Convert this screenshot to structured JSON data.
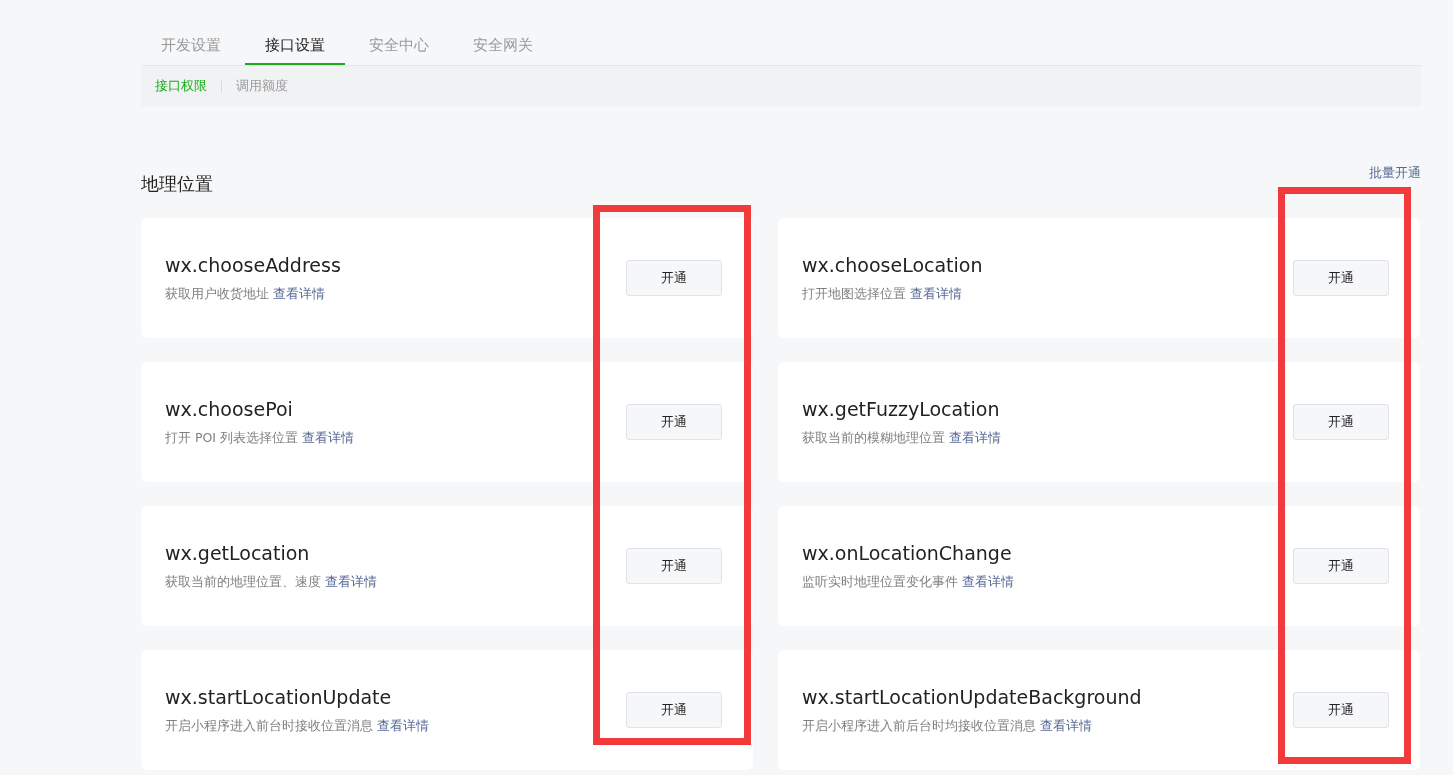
{
  "tabs": [
    {
      "label": "开发设置",
      "selected": false
    },
    {
      "label": "接口设置",
      "selected": true
    },
    {
      "label": "安全中心",
      "selected": false
    },
    {
      "label": "安全网关",
      "selected": false
    }
  ],
  "subtabs": [
    {
      "label": "接口权限",
      "selected": true
    },
    {
      "label": "调用额度",
      "selected": false
    }
  ],
  "section": {
    "title": "地理位置",
    "action": "批量开通"
  },
  "apis": [
    {
      "name": "wx.chooseAddress",
      "desc": "获取用户收货地址",
      "link": "查看详情",
      "button": "开通"
    },
    {
      "name": "wx.chooseLocation",
      "desc": "打开地图选择位置",
      "link": "查看详情",
      "button": "开通"
    },
    {
      "name": "wx.choosePoi",
      "desc": "打开 POI 列表选择位置",
      "link": "查看详情",
      "button": "开通"
    },
    {
      "name": "wx.getFuzzyLocation",
      "desc": "获取当前的模糊地理位置",
      "link": "查看详情",
      "button": "开通"
    },
    {
      "name": "wx.getLocation",
      "desc": "获取当前的地理位置、速度",
      "link": "查看详情",
      "button": "开通"
    },
    {
      "name": "wx.onLocationChange",
      "desc": "监听实时地理位置变化事件",
      "link": "查看详情",
      "button": "开通"
    },
    {
      "name": "wx.startLocationUpdate",
      "desc": "开启小程序进入前台时接收位置消息",
      "link": "查看详情",
      "button": "开通"
    },
    {
      "name": "wx.startLocationUpdateBackground",
      "desc": "开启小程序进入前后台时均接收位置消息",
      "link": "查看详情",
      "button": "开通"
    }
  ],
  "annotations": [
    {
      "kind": "highlight-box"
    },
    {
      "kind": "highlight-box"
    }
  ]
}
